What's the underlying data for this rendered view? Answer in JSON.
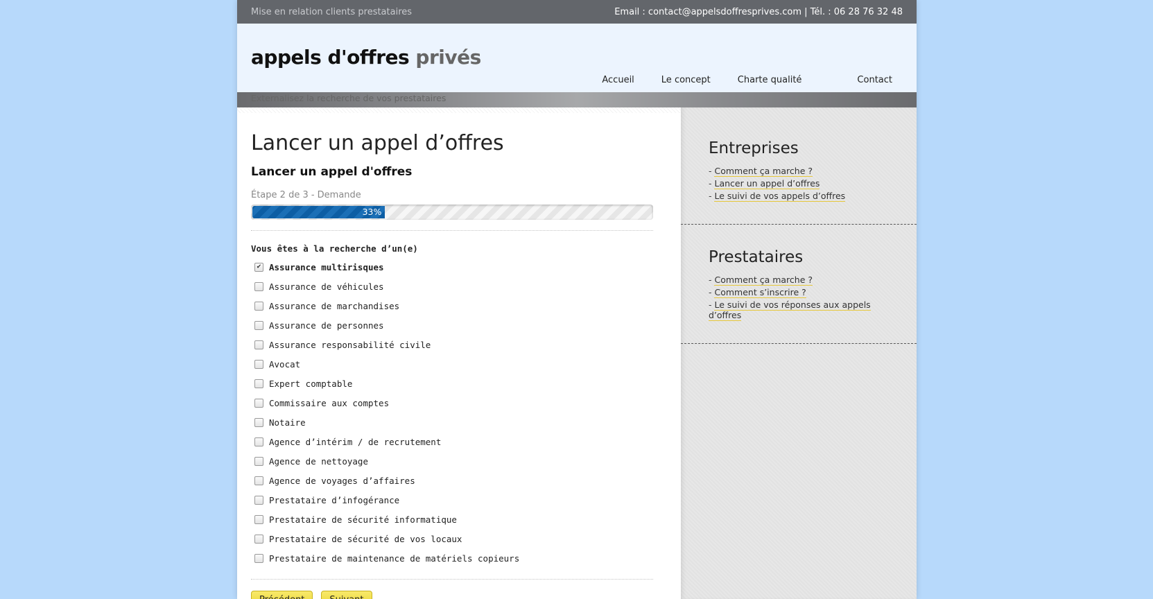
{
  "topbar": {
    "tagline": "Mise en relation clients prestataires",
    "contact": "Email : contact@appelsdoffresprives.com | Tél. : 06 28 76 32 48"
  },
  "header": {
    "logo_main": "appels d'offres",
    "logo_accent": "privés",
    "slogan": "Externalisez la recherche de vos prestataires",
    "nav": [
      "Accueil",
      "Le concept",
      "Charte qualité",
      "Contact"
    ]
  },
  "main": {
    "title": "Lancer un appel d’offres",
    "subtitle": "Lancer un appel d'offres",
    "step": "Étape 2 de 3 - Demande",
    "progress_label": "33%",
    "progress_value": 0.33,
    "question": "Vous êtes à la recherche d’un(e)",
    "options": [
      {
        "label": "Assurance multirisques",
        "checked": true
      },
      {
        "label": "Assurance de véhicules",
        "checked": false
      },
      {
        "label": "Assurance de marchandises",
        "checked": false
      },
      {
        "label": "Assurance de personnes",
        "checked": false
      },
      {
        "label": "Assurance responsabilité civile",
        "checked": false
      },
      {
        "label": "Avocat",
        "checked": false
      },
      {
        "label": "Expert comptable",
        "checked": false
      },
      {
        "label": "Commissaire aux comptes",
        "checked": false
      },
      {
        "label": "Notaire",
        "checked": false
      },
      {
        "label": "Agence d’intérim / de recrutement",
        "checked": false
      },
      {
        "label": "Agence de nettoyage",
        "checked": false
      },
      {
        "label": "Agence de voyages d’affaires",
        "checked": false
      },
      {
        "label": "Prestataire d’infogérance",
        "checked": false
      },
      {
        "label": "Prestataire de sécurité informatique",
        "checked": false
      },
      {
        "label": "Prestataire de sécurité de vos locaux",
        "checked": false
      },
      {
        "label": "Prestataire de maintenance de matériels copieurs",
        "checked": false
      }
    ],
    "prev_label": "Précédent",
    "next_label": "Suivant"
  },
  "sidebar": {
    "blocks": [
      {
        "title": "Entreprises",
        "links": [
          "Comment ça marche ?",
          "Lancer un appel d’offres",
          "Le suivi de vos appels d’offres"
        ]
      },
      {
        "title": "Prestataires",
        "links": [
          "Comment ça marche ?",
          "Comment s’inscrire ?",
          "Le suivi de vos réponses aux appels d’offres"
        ]
      }
    ]
  },
  "colors": {
    "page_background": "#b7d9fb",
    "topbar": "#63666b",
    "header": "#ecf4fe",
    "progress_bar": "#0f64ad",
    "button": "#f0dc48",
    "link_underline": "#e6c73a"
  }
}
